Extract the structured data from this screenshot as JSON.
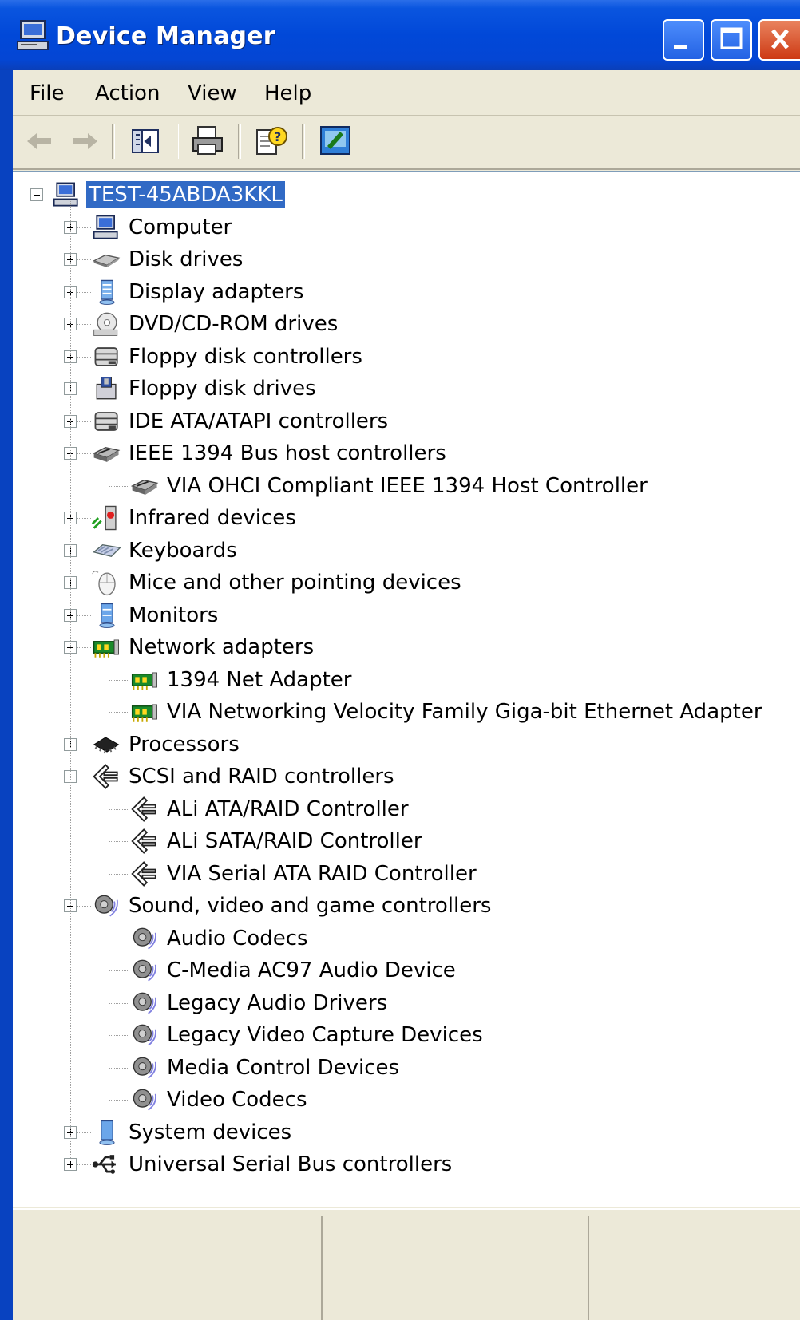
{
  "window": {
    "title": "Device Manager",
    "icons": {
      "title": "computer-monitor-icon",
      "minimize": "minimize-icon",
      "maximize": "maximize-icon",
      "close": "close-icon"
    },
    "colors": {
      "titlebar": "#0148d8",
      "selection": "#316ac5",
      "close": "#cd3a14"
    }
  },
  "menu": {
    "file": "File",
    "action": "Action",
    "view": "View",
    "help": "Help"
  },
  "toolbar": {
    "icons": [
      "back-arrow-icon",
      "forward-arrow-icon",
      "show-hide-console-tree-icon",
      "print-icon",
      "properties-help-icon",
      "scan-hardware-icon"
    ]
  },
  "tree": {
    "root": {
      "label": "TEST-45ABDA3KKL",
      "icon": "computer-icon",
      "expanded": true,
      "selected": true
    },
    "nodes": [
      {
        "label": "Computer",
        "icon": "computer-icon",
        "expanded": false
      },
      {
        "label": "Disk drives",
        "icon": "disk-drive-icon",
        "expanded": false
      },
      {
        "label": "Display adapters",
        "icon": "display-adapter-icon",
        "expanded": false
      },
      {
        "label": "DVD/CD-ROM drives",
        "icon": "cdrom-icon",
        "expanded": false
      },
      {
        "label": "Floppy disk controllers",
        "icon": "controller-icon",
        "expanded": false
      },
      {
        "label": "Floppy disk drives",
        "icon": "floppy-icon",
        "expanded": false
      },
      {
        "label": "IDE ATA/ATAPI controllers",
        "icon": "controller-icon",
        "expanded": false
      },
      {
        "label": "IEEE 1394 Bus host controllers",
        "icon": "ieee1394-icon",
        "expanded": true,
        "children": [
          {
            "label": "VIA OHCI Compliant IEEE 1394 Host Controller",
            "icon": "ieee1394-icon"
          }
        ]
      },
      {
        "label": "Infrared devices",
        "icon": "infrared-icon",
        "expanded": false
      },
      {
        "label": "Keyboards",
        "icon": "keyboard-icon",
        "expanded": false
      },
      {
        "label": "Mice and other pointing devices",
        "icon": "mouse-icon",
        "expanded": false
      },
      {
        "label": "Monitors",
        "icon": "monitor-icon",
        "expanded": false
      },
      {
        "label": "Network adapters",
        "icon": "network-card-icon",
        "expanded": true,
        "children": [
          {
            "label": "1394 Net Adapter",
            "icon": "network-card-icon"
          },
          {
            "label": "VIA Networking Velocity Family Giga-bit Ethernet Adapter",
            "icon": "network-card-icon"
          }
        ]
      },
      {
        "label": "Processors",
        "icon": "processor-icon",
        "expanded": false
      },
      {
        "label": "SCSI and RAID controllers",
        "icon": "scsi-icon",
        "expanded": true,
        "children": [
          {
            "label": "ALi ATA/RAID Controller",
            "icon": "scsi-icon"
          },
          {
            "label": "ALi SATA/RAID Controller",
            "icon": "scsi-icon"
          },
          {
            "label": "VIA Serial ATA RAID Controller",
            "icon": "scsi-icon"
          }
        ]
      },
      {
        "label": "Sound, video and game controllers",
        "icon": "speaker-icon",
        "expanded": true,
        "children": [
          {
            "label": "Audio Codecs",
            "icon": "speaker-icon"
          },
          {
            "label": "C-Media AC97 Audio Device",
            "icon": "speaker-icon"
          },
          {
            "label": "Legacy Audio Drivers",
            "icon": "speaker-icon"
          },
          {
            "label": "Legacy Video Capture Devices",
            "icon": "speaker-icon"
          },
          {
            "label": "Media Control Devices",
            "icon": "speaker-icon"
          },
          {
            "label": "Video Codecs",
            "icon": "speaker-icon"
          }
        ]
      },
      {
        "label": "System devices",
        "icon": "system-device-icon",
        "expanded": false
      },
      {
        "label": "Universal Serial Bus controllers",
        "icon": "usb-icon",
        "expanded": false
      }
    ]
  }
}
